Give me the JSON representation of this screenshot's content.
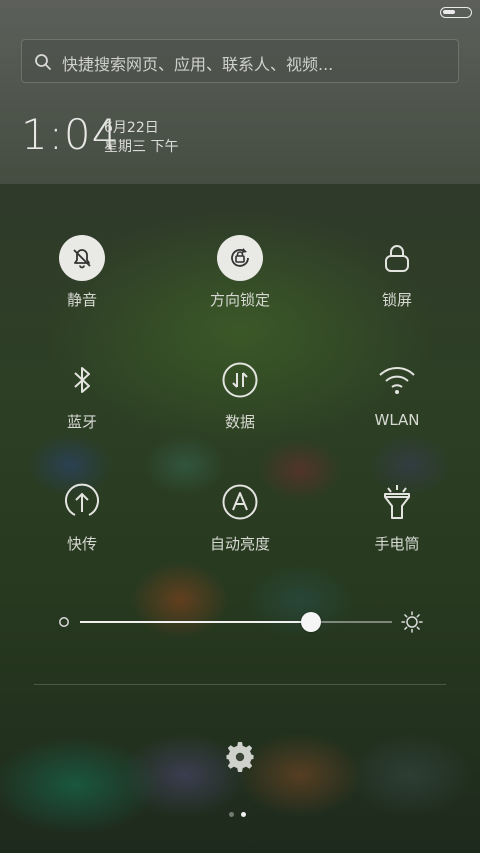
{
  "status_bar": {
    "battery_level": 0.45
  },
  "search": {
    "placeholder": "快捷搜索网页、应用、联系人、视频..."
  },
  "header": {
    "time": "1:04",
    "date": "6月22日",
    "weekday": "星期三 下午"
  },
  "toggles": [
    {
      "label": "静音",
      "icon": "bell-off-icon",
      "active": true
    },
    {
      "label": "方向锁定",
      "icon": "rotation-lock-icon",
      "active": true
    },
    {
      "label": "锁屏",
      "icon": "lock-icon",
      "active": false
    },
    {
      "label": "蓝牙",
      "icon": "bluetooth-icon",
      "active": false
    },
    {
      "label": "数据",
      "icon": "mobile-data-icon",
      "active": false
    },
    {
      "label": "WLAN",
      "icon": "wifi-icon",
      "active": false
    },
    {
      "label": "快传",
      "icon": "transfer-icon",
      "active": false
    },
    {
      "label": "自动亮度",
      "icon": "auto-brightness-icon",
      "active": false
    },
    {
      "label": "手电筒",
      "icon": "flashlight-icon",
      "active": false
    }
  ],
  "brightness": {
    "level": 0.74
  },
  "pager": {
    "pages": 2,
    "current": 2
  },
  "colors": {
    "active_toggle_bg": "#e9e9e6",
    "icon": "#e6e6e6"
  }
}
